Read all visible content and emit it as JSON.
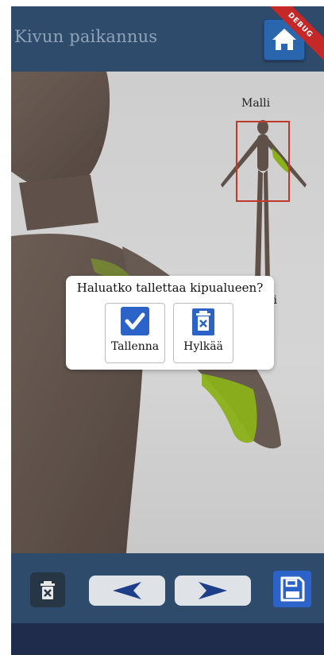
{
  "app_bar": {
    "title": "Kivun paikannus",
    "home_icon": "home-icon",
    "debug_banner": "DEBUG"
  },
  "stage": {
    "model_label": "Malli",
    "model_label_partial": "li",
    "highlight_color": "#9cc71a",
    "selection_box_color": "#c0392b"
  },
  "dialog": {
    "title": "Haluatko tallettaa kipualueen?",
    "save_label": "Tallenna",
    "save_icon": "check-icon",
    "discard_label": "Hylkää",
    "discard_icon": "trash-x-icon"
  },
  "toolbar": {
    "delete_icon": "trash-x-icon",
    "prev_icon": "arrow-left-icon",
    "next_icon": "arrow-right-icon",
    "save_icon": "floppy-disk-icon"
  },
  "colors": {
    "bar_background": "#2f4b6b",
    "accent_blue": "#2b63c9"
  }
}
